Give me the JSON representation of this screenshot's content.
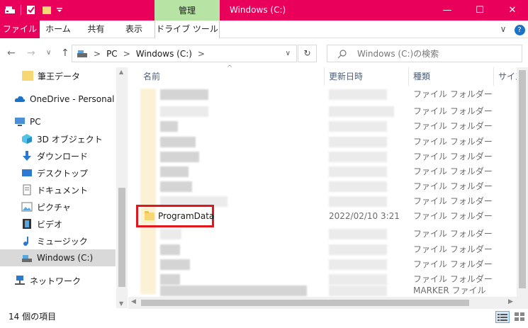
{
  "titlebar": {
    "manage_label": "管理",
    "window_title": "Windows (C:)",
    "minimize": "—",
    "maximize": "☐",
    "close": "✕"
  },
  "ribbon": {
    "tabs": [
      "ファイル",
      "ホーム",
      "共有",
      "表示",
      "ドライブ ツール"
    ],
    "collapse": "∨",
    "help": "?"
  },
  "address": {
    "back": "←",
    "forward": "→",
    "recent": "∨",
    "up": "↑",
    "path": [
      "PC",
      "Windows (C:)"
    ],
    "sep": ">",
    "dropdown": "∨",
    "refresh": "↻",
    "search_placeholder": "Windows (C:)の検索"
  },
  "sidebar": {
    "items": [
      {
        "label": "筆王データ",
        "icon": "folder-icon"
      },
      {
        "label": "OneDrive - Personal",
        "icon": "onedrive-cloud-icon"
      },
      {
        "label": "PC",
        "icon": "pc-icon"
      },
      {
        "label": "3D オブジェクト",
        "icon": "3d-objects-icon"
      },
      {
        "label": "ダウンロード",
        "icon": "download-arrow-icon"
      },
      {
        "label": "デスクトップ",
        "icon": "desktop-icon"
      },
      {
        "label": "ドキュメント",
        "icon": "documents-icon"
      },
      {
        "label": "ピクチャ",
        "icon": "pictures-icon"
      },
      {
        "label": "ビデオ",
        "icon": "videos-icon"
      },
      {
        "label": "ミュージック",
        "icon": "music-note-icon"
      },
      {
        "label": "Windows (C:)",
        "icon": "drive-icon"
      },
      {
        "label": "ネットワーク",
        "icon": "network-icon"
      }
    ]
  },
  "columns": {
    "name": "名前",
    "modified": "更新日時",
    "type": "種類",
    "size": "サイズ"
  },
  "files": {
    "highlighted_name": "ProgramData",
    "highlighted_date": "2022/02/10 3:21",
    "types": [
      "ファイル フォルダー",
      "ファイル フォルダー",
      "ファイル フォルダー",
      "ファイル フォルダー",
      "ファイル フォルダー",
      "ファイル フォルダー",
      "ファイル フォルダー",
      "ファイル フォルダー",
      "ファイル フォルダー",
      "ファイル フォルダー",
      "ファイル フォルダー",
      "ファイル フォルダー",
      "ファイル フォルダー",
      "MARKER ファイル"
    ],
    "highlight_color": "#e0171f"
  },
  "status": {
    "item_count": "14 個の項目"
  }
}
